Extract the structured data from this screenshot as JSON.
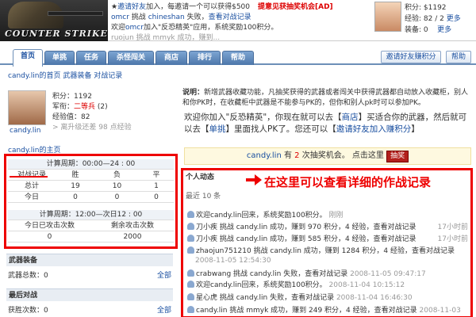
{
  "banner": {
    "logo_text": "COUNTER STRIKE",
    "feed": [
      {
        "pre": "★",
        "link": "邀请好友",
        "text": "加入，每邀请一个可以获得$500",
        "ad": "提意见获抽奖机会[AD]"
      },
      {
        "link": "omcr",
        "mid": "挑战",
        "link2": "chineshan",
        "text": "失败，",
        "link3": "查看对战记录"
      },
      {
        "pre": "欢迎",
        "link": "omcr",
        "text": "加入\"反恐精英\"应用，系统奖励100积分。"
      },
      {
        "text": "ruojun 挑战 mmyk 成功，赚到..."
      }
    ],
    "user_mini": {
      "score": "积分: $1192",
      "level": "经验: 82 / 2",
      "level_link": "更多",
      "equip": "装备: 0",
      "equip_link": "更多"
    }
  },
  "nav": {
    "tabs": [
      "首页",
      "单挑",
      "任务",
      "杀怪闯关",
      "商店",
      "排行",
      "帮助"
    ],
    "invite": "邀请好友赚积分",
    "help": "帮助"
  },
  "breadcrumb": "candy.lin的首页 武器装备 对战记录",
  "profile": {
    "name": "candy.lin",
    "score_label": "积分：",
    "score": "1192",
    "rank_label": "军衔：",
    "rank": "二等兵",
    "rank_num": "(2)",
    "exp_label": "经验值：",
    "exp": "82",
    "upgrade_note": "> 离升级还差 98 点经验",
    "homepage": "candy.lin的主页"
  },
  "record": {
    "period1": "计算周期：00:00—24 : 00",
    "headers": [
      "对战记录",
      "胜",
      "负",
      "平"
    ],
    "rows": [
      {
        "label": "总计",
        "win": "19",
        "lose": "10",
        "draw": "1"
      },
      {
        "label": "今日",
        "win": "0",
        "lose": "0",
        "draw": "0"
      }
    ],
    "period2": "计算周期：12:00—次日12 : 00",
    "sub_headers": [
      "今日已攻击次数",
      "剩余攻击次数"
    ],
    "sub_values": [
      "0",
      "2000"
    ]
  },
  "sections": {
    "weapons": {
      "title": "武器装备",
      "text": "武器总数：0",
      "link": "全部"
    },
    "recent": {
      "title": "最后对战",
      "text": "获胜次数：0",
      "link": "全部"
    }
  },
  "notice": {
    "label": "说明：",
    "text": "新增武器收藏功能，凡抽奖获得的武器或者闯关中获得武器都自动放入收藏柜，别人和你PK时，在收藏柜中武器是不能参与PK的，但你和别人pk时可以参加PK。"
  },
  "welcome": {
    "p1": "欢迎你加入\"反恐精英\"，你现在就可以去【",
    "shop": "商店",
    "p2": "】买适合你的武器，然后就可以去【",
    "duel": "单挑",
    "p3": "】里面找人PK了。您还可以【",
    "invite": "邀请好友加入赚积分",
    "p4": "】"
  },
  "lottery": {
    "name": "candy.lin",
    "pre": " 有 ",
    "count": "2",
    "post": " 次抽奖机会。 点击这里 ",
    "button": "抽奖"
  },
  "activity": {
    "title": "个人动态",
    "count": "最近 10 条",
    "callout": "在这里可以查看详细的作战记录",
    "items": [
      {
        "text": "欢迎candy.lin回来，系统奖励100积分。",
        "time": "刚刚"
      },
      {
        "text": "刀小疾 挑战 candy.lin 成功，赚到 970 积分，4 经验，查看对战记录",
        "time": "17小时前"
      },
      {
        "text": "刀小疾 挑战 candy.lin 成功，赚到 585 积分，4 经验，查看对战记录",
        "time": "17小时前"
      },
      {
        "text": "zhaojun751210 挑战 candy.lin 成功，赚到 1284 积分，4 经验，查看对战记录",
        "time": ""
      },
      {
        "text": "crabwang 挑战 candy.lin 失败，查看对战记录",
        "time": "2008-11-05 09:47:17"
      },
      {
        "text": "欢迎candy.lin回来，系统奖励100积分。",
        "time": "2008-11-04 10:15:12"
      },
      {
        "text": "星心虎 挑战 candy.lin 失败，查看对战记录",
        "time": "2008-11-04 16:46:30"
      },
      {
        "text": "candy.lin 挑战 mmyk 成功，赚到 249 积分，4 经验，查看对战记录",
        "time": "2008-11-03"
      }
    ],
    "times_below": [
      "2008-11-05 12:54:30",
      "2008-11-05 09:47:17",
      "2008-11-04 10:15:12",
      "2008-11-04 16:46:30"
    ]
  }
}
